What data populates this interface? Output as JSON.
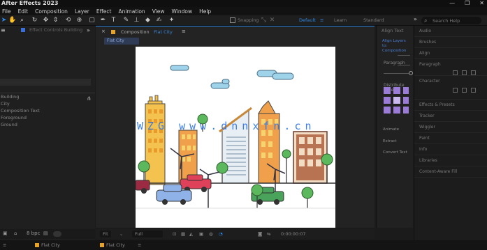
{
  "app": {
    "title": "After Effects 2023"
  },
  "window_controls": [
    "—",
    "❐",
    "✕"
  ],
  "menu": [
    "File",
    "Edit",
    "Composition",
    "Layer",
    "Effect",
    "Animation",
    "View",
    "Window",
    "Help"
  ],
  "toolbar": {
    "snapping_label": "Snapping",
    "workspaces": [
      "Default",
      "Learn",
      "Standard"
    ],
    "workspaces_more": "»",
    "search_placeholder": "Search Help"
  },
  "project_panel": {
    "tab_label": "Effect Controls Building",
    "more": "»",
    "items": [
      "Building",
      "City",
      "Composition Text",
      "Foreground",
      "Ground"
    ],
    "footer_bpc": "8 bpc"
  },
  "composition_panel": {
    "tab_prefix": "Composition",
    "tab_name": "Flat City",
    "flowchart_chip": "Flat City",
    "footer": {
      "zoom": "Fit",
      "resolution": "Full",
      "timecode": "0:00:00:07"
    }
  },
  "bottom_tabs": [
    {
      "label": "Flat City",
      "color": "#e7a326"
    },
    {
      "label": "Flat City",
      "color": "#e7a326"
    }
  ],
  "align_panel": {
    "header": "Align Text",
    "highlight": "Align Layers to: Composition",
    "labels": [
      "Paragraph",
      "Distribute Layers"
    ],
    "sections": [
      "Animate",
      "Extract",
      "Convert Text"
    ]
  },
  "right_panel": {
    "items": [
      "Audio",
      "Brushes",
      "Align",
      "Paragraph",
      "Character",
      "Effects & Presets",
      "Tracker",
      "Wiggler",
      "Paint",
      "Info",
      "Libraries",
      "Content-Aware Fill"
    ]
  },
  "watermark": "WZG www.dnnxfn.cn"
}
